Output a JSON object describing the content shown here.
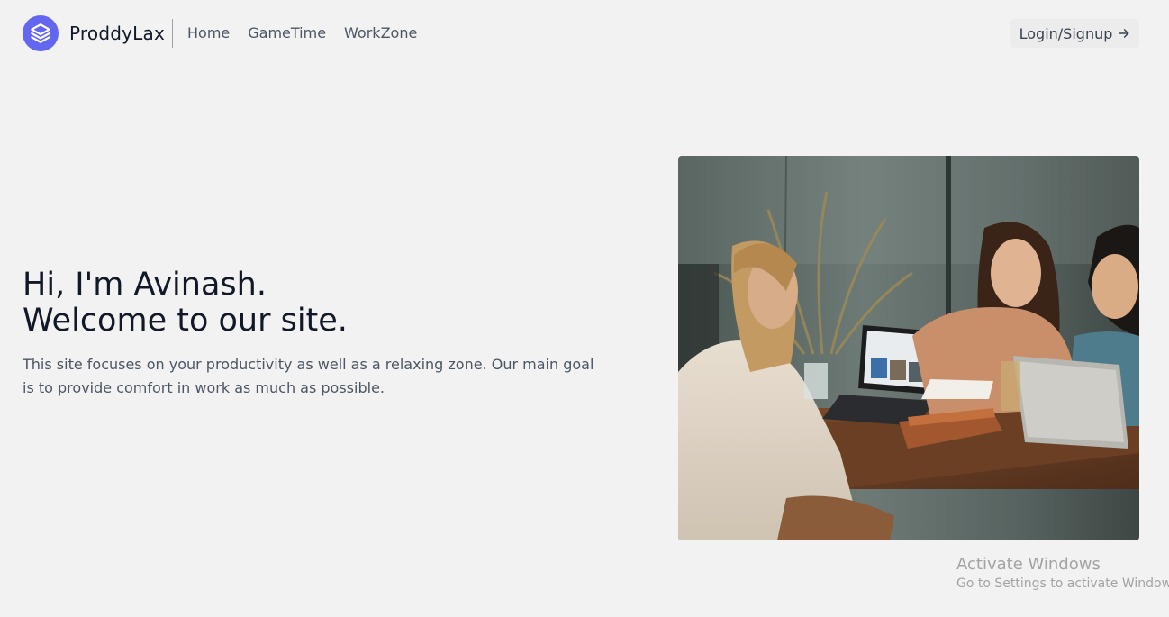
{
  "brand": {
    "name": "ProddyLax",
    "logo_icon": "layers-icon",
    "accent_color": "#6366f1"
  },
  "nav": {
    "items": [
      {
        "label": "Home"
      },
      {
        "label": "GameTime"
      },
      {
        "label": "WorkZone"
      }
    ]
  },
  "login": {
    "label": "Login/Signup",
    "icon": "arrow-right-icon"
  },
  "hero": {
    "title_line1": "Hi, I'm Avinash.",
    "title_line2": "Welcome to our site.",
    "description": "This site focuses on your productivity as well as a relaxing zone. Our main goal is to provide comfort in work as much as possible."
  },
  "watermark": {
    "title": "Activate Windows",
    "subtitle": "Go to Settings to activate Windows."
  }
}
